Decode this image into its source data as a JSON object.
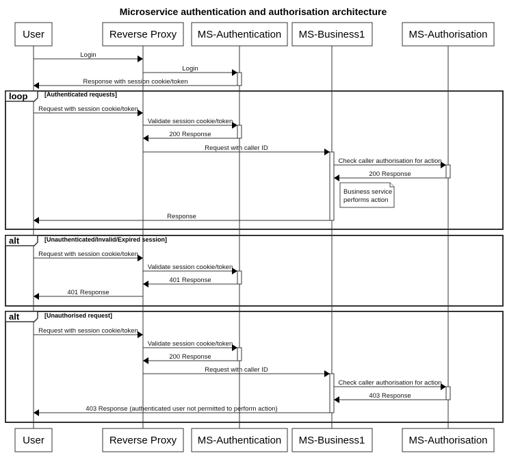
{
  "title": "Microservice authentication and authorisation architecture",
  "participants": [
    {
      "id": "user",
      "label": "User"
    },
    {
      "id": "proxy",
      "label": "Reverse Proxy"
    },
    {
      "id": "authn",
      "label": "MS-Authentication"
    },
    {
      "id": "biz",
      "label": "MS-Business1"
    },
    {
      "id": "authz",
      "label": "MS-Authorisation"
    }
  ],
  "messages": [
    {
      "from": "user",
      "to": "proxy",
      "label": "Login"
    },
    {
      "from": "proxy",
      "to": "authn",
      "label": "Login"
    },
    {
      "from": "authn",
      "to": "user",
      "label": "Response with session cookie/token"
    },
    {
      "from": "user",
      "to": "proxy",
      "label": "Request with session cookie/token"
    },
    {
      "from": "proxy",
      "to": "authn",
      "label": "Validate session cookie/token"
    },
    {
      "from": "authn",
      "to": "proxy",
      "label": "200 Response"
    },
    {
      "from": "proxy",
      "to": "biz",
      "label": "Request with caller ID"
    },
    {
      "from": "biz",
      "to": "authz",
      "label": "Check caller authorisation for action"
    },
    {
      "from": "authz",
      "to": "biz",
      "label": "200 Response"
    },
    {
      "from": "biz",
      "to": "user",
      "label": "Response"
    },
    {
      "from": "user",
      "to": "proxy",
      "label": "Request with session cookie/token"
    },
    {
      "from": "proxy",
      "to": "authn",
      "label": "Validate session cookie/token"
    },
    {
      "from": "authn",
      "to": "proxy",
      "label": "401 Response"
    },
    {
      "from": "proxy",
      "to": "user",
      "label": "401 Response"
    },
    {
      "from": "user",
      "to": "proxy",
      "label": "Request with session cookie/token"
    },
    {
      "from": "proxy",
      "to": "authn",
      "label": "Validate session cookie/token"
    },
    {
      "from": "authn",
      "to": "proxy",
      "label": "200 Response"
    },
    {
      "from": "proxy",
      "to": "biz",
      "label": "Request with caller ID"
    },
    {
      "from": "biz",
      "to": "authz",
      "label": "Check caller authorisation for action"
    },
    {
      "from": "authz",
      "to": "biz",
      "label": "403 Response"
    },
    {
      "from": "biz",
      "to": "user",
      "label": "403 Response (authenticated user not permitted to perform action)"
    }
  ],
  "frames": [
    {
      "keyword": "loop",
      "guard": "[Authenticated requests]"
    },
    {
      "keyword": "alt",
      "guard": "[Unauthenticated/Invalid/Expired session]"
    },
    {
      "keyword": "alt",
      "guard": "[Unauthorised request]"
    }
  ],
  "note": {
    "lines": [
      "Business service",
      "performs action"
    ]
  }
}
